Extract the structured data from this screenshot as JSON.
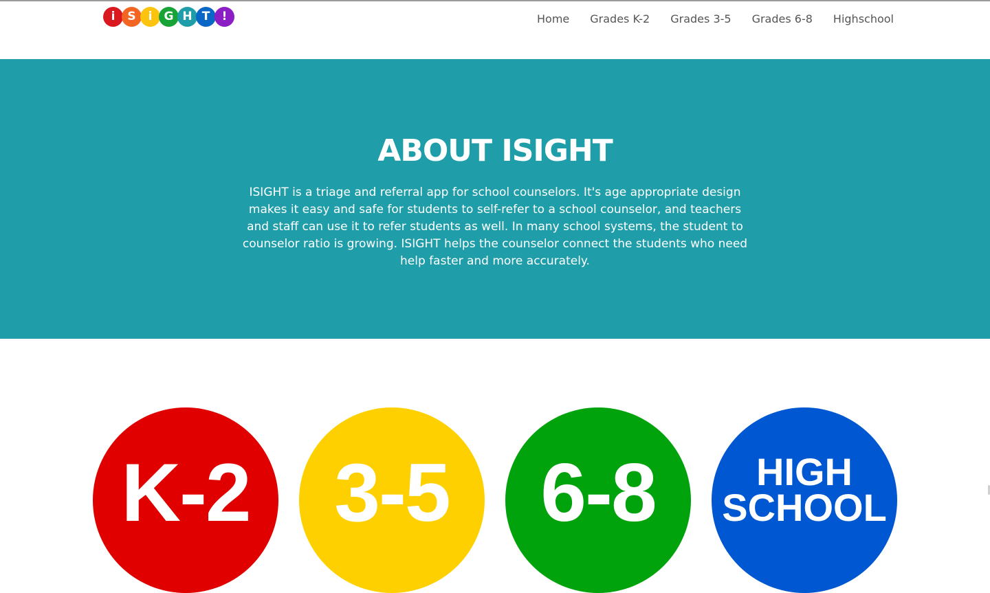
{
  "header": {
    "logo": {
      "letters": [
        "i",
        "S",
        "i",
        "G",
        "H",
        "T",
        "!"
      ],
      "colors": [
        "#d9181f",
        "#f26522",
        "#fcc40f",
        "#18a337",
        "#1f9ea9",
        "#0b67c6",
        "#8b1ec4"
      ]
    },
    "nav": [
      "Home",
      "Grades K-2",
      "Grades 3-5",
      "Grades 6-8",
      "Highschool"
    ]
  },
  "hero": {
    "title": "ABOUT ISIGHT",
    "text": "ISIGHT is a triage and referral app for school counselors. It's age appropriate design makes it easy and safe for students to self-refer to a school counselor, and teachers and staff can use it to refer students as well. In many school systems, the student to counselor ratio is growing. ISIGHT helps the counselor connect the students who need help faster and more accurately.",
    "background": "#1f9ea9"
  },
  "grades": [
    {
      "label": "K-2",
      "color": "#e00000"
    },
    {
      "label": "3-5",
      "color": "#ffd000"
    },
    {
      "label": "6-8",
      "color": "#00a30c"
    },
    {
      "label": "HIGH\nSCHOOL",
      "color": "#0057d2"
    }
  ]
}
